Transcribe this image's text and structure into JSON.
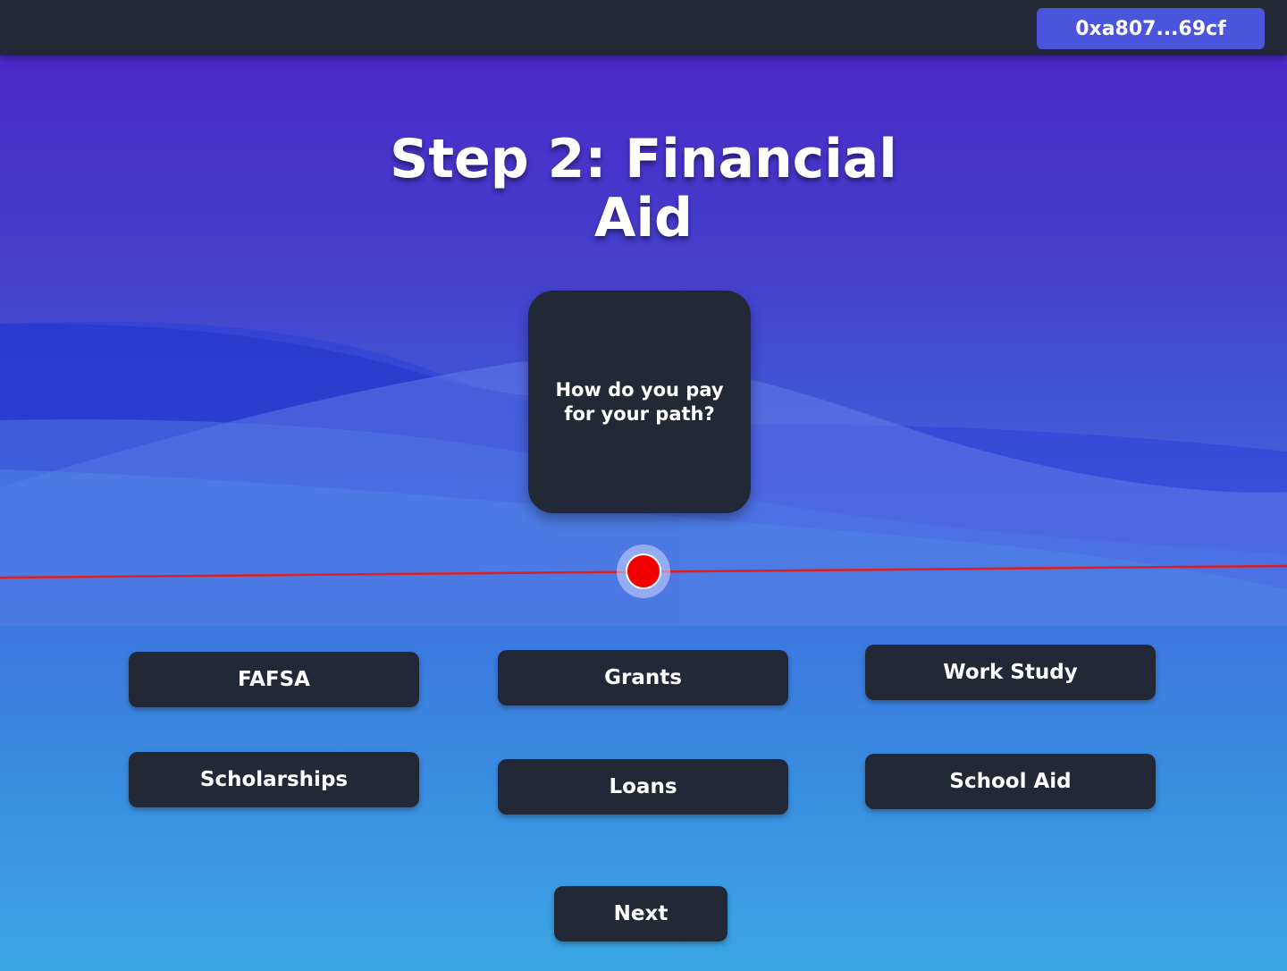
{
  "header": {
    "wallet_address": "0xa807...69cf"
  },
  "main": {
    "title_line1": "Step 2: Financial",
    "title_line2": "Aid",
    "question": "How do you pay for your path?",
    "options": [
      {
        "label": "FAFSA"
      },
      {
        "label": "Grants"
      },
      {
        "label": "Work Study"
      },
      {
        "label": "Scholarships"
      },
      {
        "label": "Loans"
      },
      {
        "label": "School Aid"
      }
    ],
    "next_label": "Next"
  },
  "colors": {
    "topbar": "#222835",
    "wallet_button": "#4a55dc",
    "card": "#222835",
    "slider_dot": "#f20000",
    "track_line": "#e01e1e"
  }
}
